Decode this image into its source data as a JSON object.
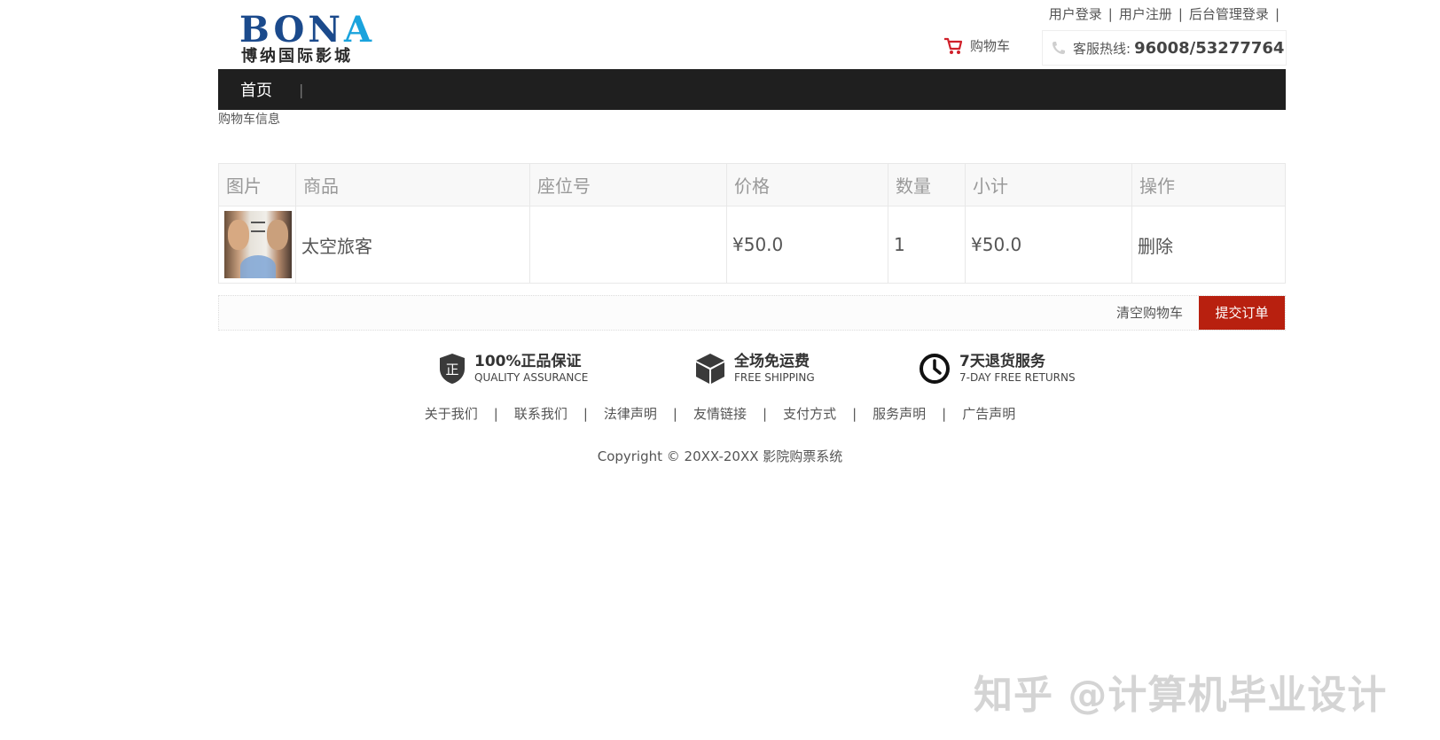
{
  "header": {
    "logo_text": "BONA",
    "logo_subtitle": "博纳国际影城",
    "top_links": [
      "用户登录",
      "用户注册",
      "后台管理登录"
    ],
    "cart_label": "购物车",
    "hotline_label": "客服热线:",
    "hotline_number": "96008/53277764"
  },
  "nav": {
    "home": "首页",
    "separator": "|"
  },
  "breadcrumb": "购物车信息",
  "cart_table": {
    "columns": [
      "图片",
      "商品",
      "座位号",
      "价格",
      "数量",
      "小计",
      "操作"
    ],
    "rows": [
      {
        "image": "movie-poster",
        "product": "太空旅客",
        "seat": "",
        "price": "¥50.0",
        "quantity": "1",
        "subtotal": "¥50.0",
        "action": "删除"
      }
    ]
  },
  "actions": {
    "clear_cart": "清空购物车",
    "submit_order": "提交订单"
  },
  "services": [
    {
      "icon": "shield-icon",
      "title": "100%正品保证",
      "subtitle": "QUALITY ASSURANCE"
    },
    {
      "icon": "box-icon",
      "title": "全场免运费",
      "subtitle": "FREE SHIPPING"
    },
    {
      "icon": "clock-icon",
      "title": "7天退货服务",
      "subtitle": "7-DAY FREE RETURNS"
    }
  ],
  "footer": {
    "links": [
      "关于我们",
      "联系我们",
      "法律声明",
      "友情链接",
      "支付方式",
      "服务声明",
      "广告声明"
    ],
    "copyright": "Copyright © 20XX-20XX 影院购票系统"
  },
  "watermark": "知乎 @计算机毕业设计",
  "colors": {
    "nav_bg": "#1f1f1f",
    "submit_bg": "#b8200f",
    "cart_icon": "#d0202a",
    "logo_blue": "#1b4a8c"
  }
}
